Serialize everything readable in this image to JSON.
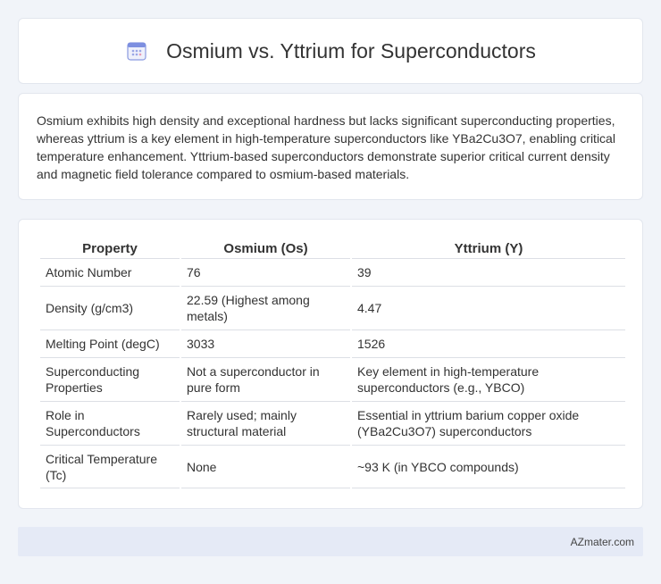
{
  "header": {
    "icon": "calendar-icon",
    "title": "Osmium vs. Yttrium for Superconductors"
  },
  "intro": {
    "text": "Osmium exhibits high density and exceptional hardness but lacks significant superconducting properties, whereas yttrium is a key element in high-temperature superconductors like YBa2Cu3O7, enabling critical temperature enhancement. Yttrium-based superconductors demonstrate superior critical current density and magnetic field tolerance compared to osmium-based materials."
  },
  "table": {
    "headers": [
      "Property",
      "Osmium (Os)",
      "Yttrium (Y)"
    ],
    "rows": [
      [
        "Atomic Number",
        "76",
        "39"
      ],
      [
        "Density (g/cm3)",
        "22.59 (Highest among metals)",
        "4.47"
      ],
      [
        "Melting Point (degC)",
        "3033",
        "1526"
      ],
      [
        "Superconducting Properties",
        "Not a superconductor in pure form",
        "Key element in high-temperature superconductors (e.g., YBCO)"
      ],
      [
        "Role in Superconductors",
        "Rarely used; mainly structural material",
        "Essential in yttrium barium copper oxide (YBa2Cu3O7) superconductors"
      ],
      [
        "Critical Temperature (Tc)",
        "None",
        "~93 K (in YBCO compounds)"
      ]
    ]
  },
  "footer": {
    "brand": "AZmater.com"
  },
  "colors": {
    "background": "#f1f4f9",
    "card": "#ffffff",
    "footer_band": "#e5eaf6",
    "icon_accent": "#6b7fd7"
  }
}
